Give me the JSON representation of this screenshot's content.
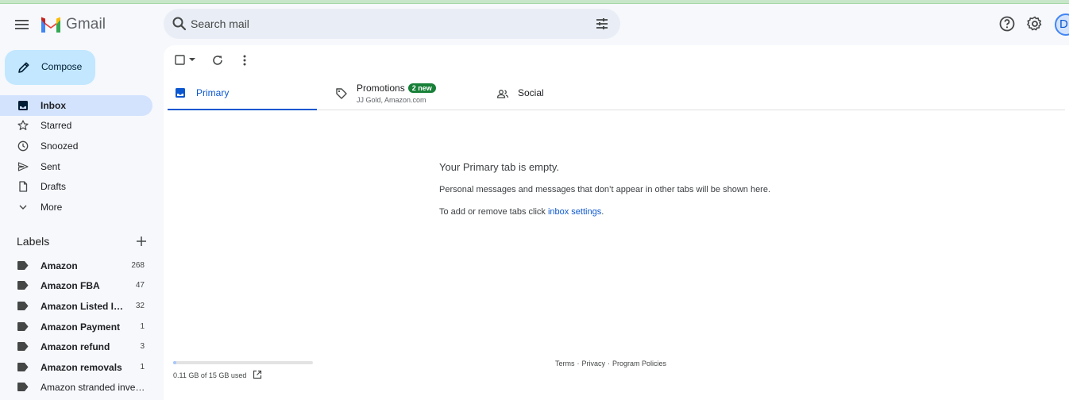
{
  "app": {
    "name": "Gmail"
  },
  "search": {
    "placeholder": "Search mail"
  },
  "compose": {
    "label": "Compose"
  },
  "nav": {
    "items": [
      {
        "label": "Inbox",
        "icon": "inbox-icon",
        "active": true
      },
      {
        "label": "Starred",
        "icon": "star-icon"
      },
      {
        "label": "Snoozed",
        "icon": "clock-icon"
      },
      {
        "label": "Sent",
        "icon": "send-icon"
      },
      {
        "label": "Drafts",
        "icon": "draft-icon"
      },
      {
        "label": "More",
        "icon": "chevron-down-icon"
      }
    ]
  },
  "labels": {
    "heading": "Labels",
    "items": [
      {
        "name": "Amazon",
        "count": "268"
      },
      {
        "name": "Amazon FBA",
        "count": "47"
      },
      {
        "name": "Amazon Listed Ite...",
        "count": "32"
      },
      {
        "name": "Amazon Payment",
        "count": "1"
      },
      {
        "name": "Amazon refund",
        "count": "3"
      },
      {
        "name": "Amazon removals",
        "count": "1"
      },
      {
        "name": "Amazon stranded invent...",
        "count": ""
      }
    ]
  },
  "tabs": [
    {
      "label": "Primary",
      "icon": "inbox-tab-icon",
      "active": true
    },
    {
      "label": "Promotions",
      "icon": "tag-icon",
      "badge": "2 new",
      "subtitle": "JJ Gold, Amazon.com"
    },
    {
      "label": "Social",
      "icon": "people-icon"
    }
  ],
  "empty": {
    "title": "Your Primary tab is empty.",
    "description": "Personal messages and messages that don’t appear in other tabs will be shown here.",
    "hint_prefix": "To add or remove tabs click ",
    "hint_link": "inbox settings",
    "hint_suffix": "."
  },
  "storage": {
    "text": "0.11 GB of 15 GB used",
    "used_fraction": 0.0073
  },
  "footer": {
    "terms": "Terms",
    "privacy": "Privacy",
    "policies": "Program Policies",
    "separator": "·"
  },
  "user": {
    "initial": "D"
  },
  "colors": {
    "accent": "#0b57d0",
    "compose_bg": "#c2e7ff",
    "badge_green": "#188038",
    "active_nav": "#d3e3fd"
  }
}
